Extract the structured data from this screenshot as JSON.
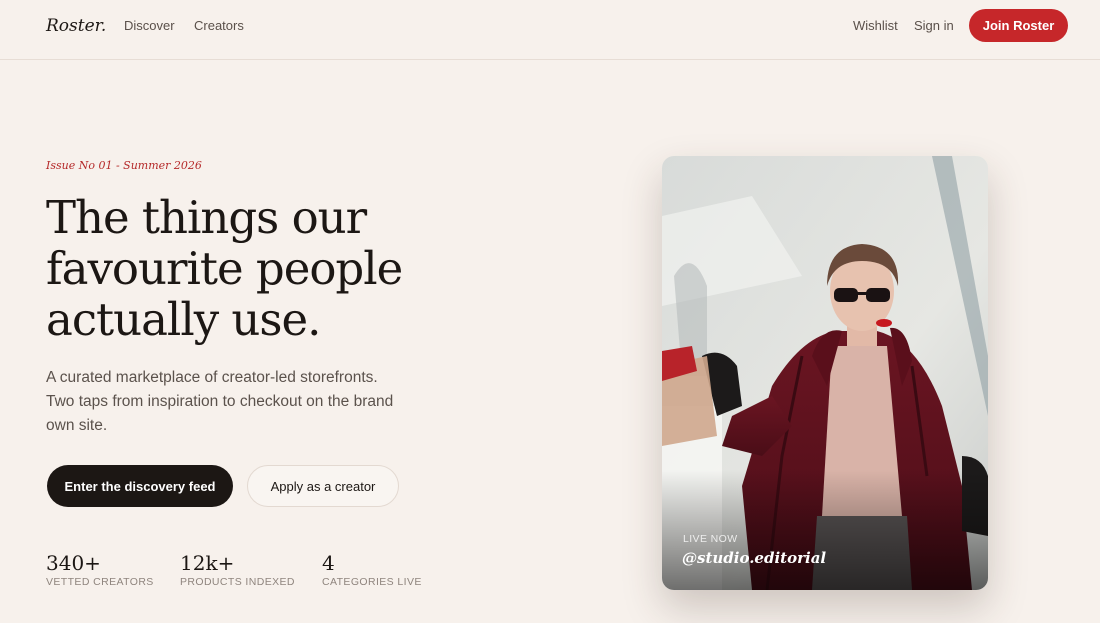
{
  "nav": {
    "logo": "Roster.",
    "links": [
      "Discover",
      "Creators"
    ],
    "wishlist": "Wishlist",
    "sign_in": "Sign in",
    "join": "Join Roster"
  },
  "hero": {
    "eyebrow": "Issue No 01 - Summer 2026",
    "headline_lines": [
      "The things our",
      "favourite people",
      "actually use."
    ],
    "subtitle_lines": [
      "A curated marketplace of creator-led storefronts.",
      "Two taps from inspiration to checkout on the brand",
      "own site."
    ],
    "primary_cta": "Enter the discovery feed",
    "secondary_cta": "Apply as a creator"
  },
  "stats": [
    {
      "value": "340+",
      "label": "VETTED CREATORS"
    },
    {
      "value": "12k+",
      "label": "PRODUCTS INDEXED"
    },
    {
      "value": "4",
      "label": "CATEGORIES LIVE"
    }
  ],
  "card": {
    "status": "LIVE NOW",
    "handle": "@studio.editorial"
  },
  "colors": {
    "background": "#f7f1ec",
    "accent": "#c6272a",
    "ink": "#1c1714"
  }
}
